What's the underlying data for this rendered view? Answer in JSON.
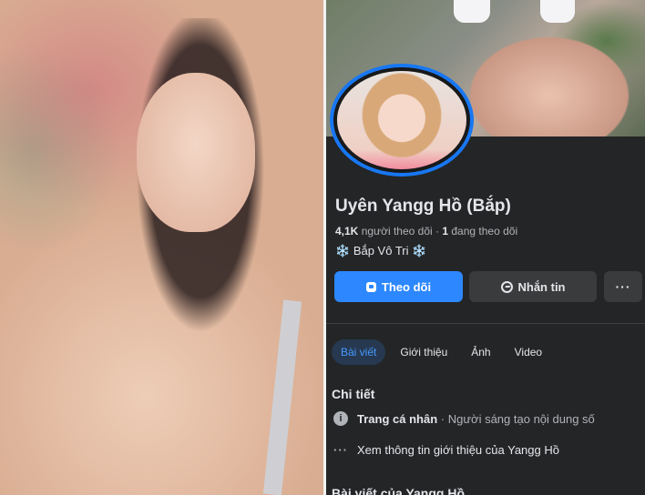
{
  "profile": {
    "name": "Uyên Yangg Hồ (Bắp)",
    "followers_count": "4,1K",
    "followers_label": "người theo dõi",
    "stats_separator": "·",
    "following_count": "1",
    "following_label": "đang theo dõi",
    "bio_text": "Bắp Vô Tri",
    "bio_emoji": "❄️"
  },
  "actions": {
    "follow_label": "Theo dõi",
    "message_label": "Nhắn tin",
    "more_label": "···"
  },
  "tabs": [
    {
      "label": "Bài viết",
      "active": true
    },
    {
      "label": "Giới thiệu",
      "active": false
    },
    {
      "label": "Ảnh",
      "active": false
    },
    {
      "label": "Video",
      "active": false
    }
  ],
  "details": {
    "title": "Chi tiết",
    "page_type_label": "Trang cá nhân",
    "page_type_separator": "·",
    "page_type_value": "Người sáng tạo nội dung số",
    "see_more": "Xem thông tin giới thiệu của Yangg Hồ"
  },
  "posts_section_title": "Bài viết của Yangg Hồ",
  "colors": {
    "background": "#242526",
    "primary_blue": "#2d88ff",
    "secondary_button": "#3a3b3c",
    "active_tab_bg": "#263951",
    "active_tab_text": "#4599ff",
    "avatar_ring": "#1877f2"
  },
  "icons": {
    "follow": "follow-icon",
    "message": "messenger-icon",
    "more": "more-dots-icon",
    "info": "info-icon",
    "see_more": "dots-icon"
  }
}
